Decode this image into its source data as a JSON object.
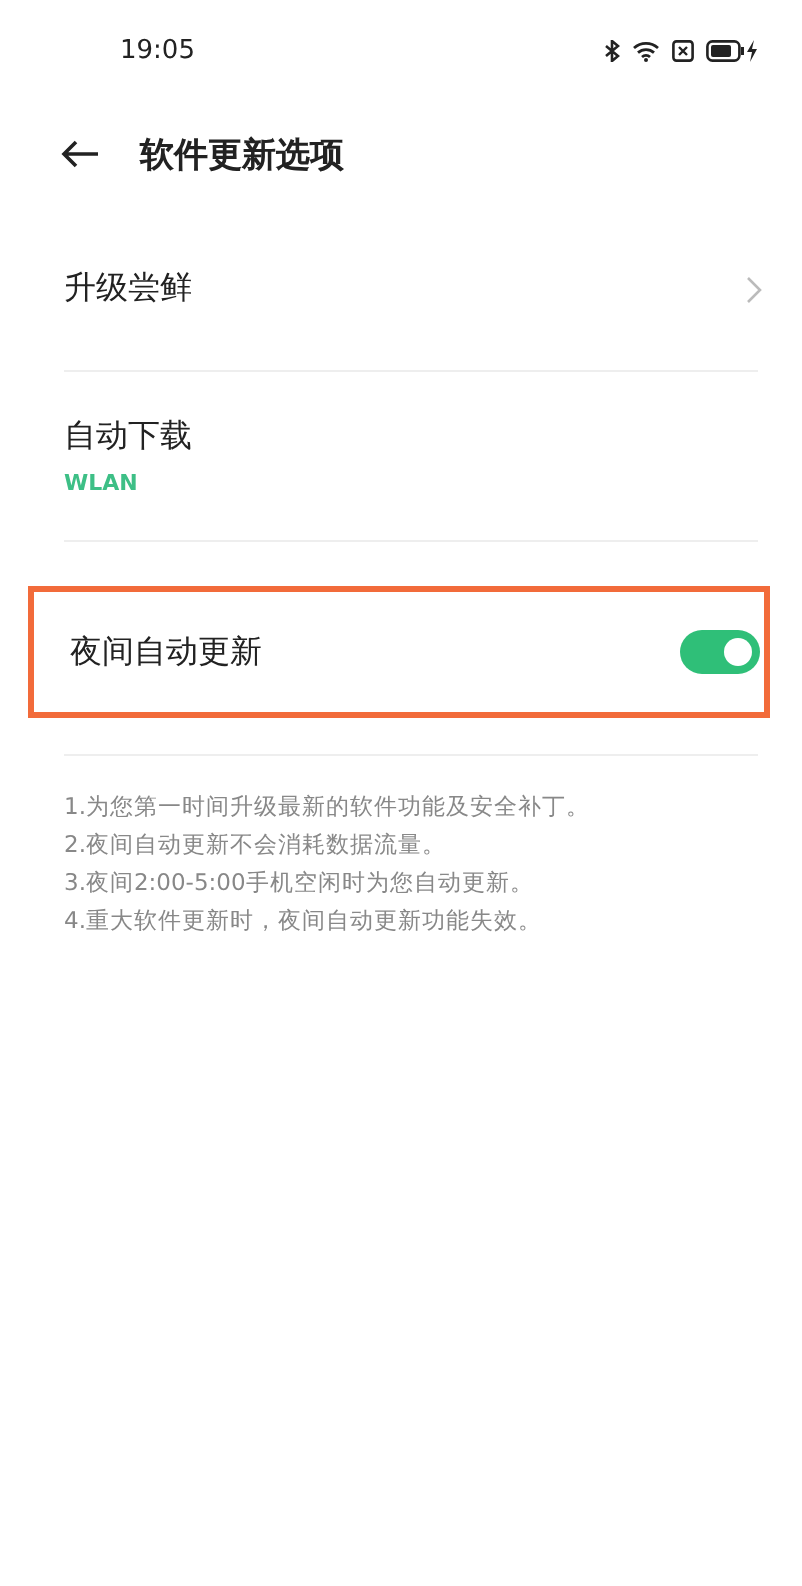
{
  "status_bar": {
    "time": "19:05"
  },
  "header": {
    "title": "软件更新选项"
  },
  "items": [
    {
      "kind": "link",
      "label": "升级尝鲜",
      "highlighted": false
    },
    {
      "kind": "value",
      "label": "自动下载",
      "value": "WLAN",
      "highlighted": false
    },
    {
      "kind": "switch",
      "label": "夜间自动更新",
      "on": true,
      "highlighted": true
    }
  ],
  "notes": [
    "1.为您第一时间升级最新的软件功能及安全补丁。",
    "2.夜间自动更新不会消耗数据流量。",
    "3.夜间2:00-5:00手机空闲时为您自动更新。",
    "4.重大软件更新时，夜间自动更新功能失效。"
  ]
}
